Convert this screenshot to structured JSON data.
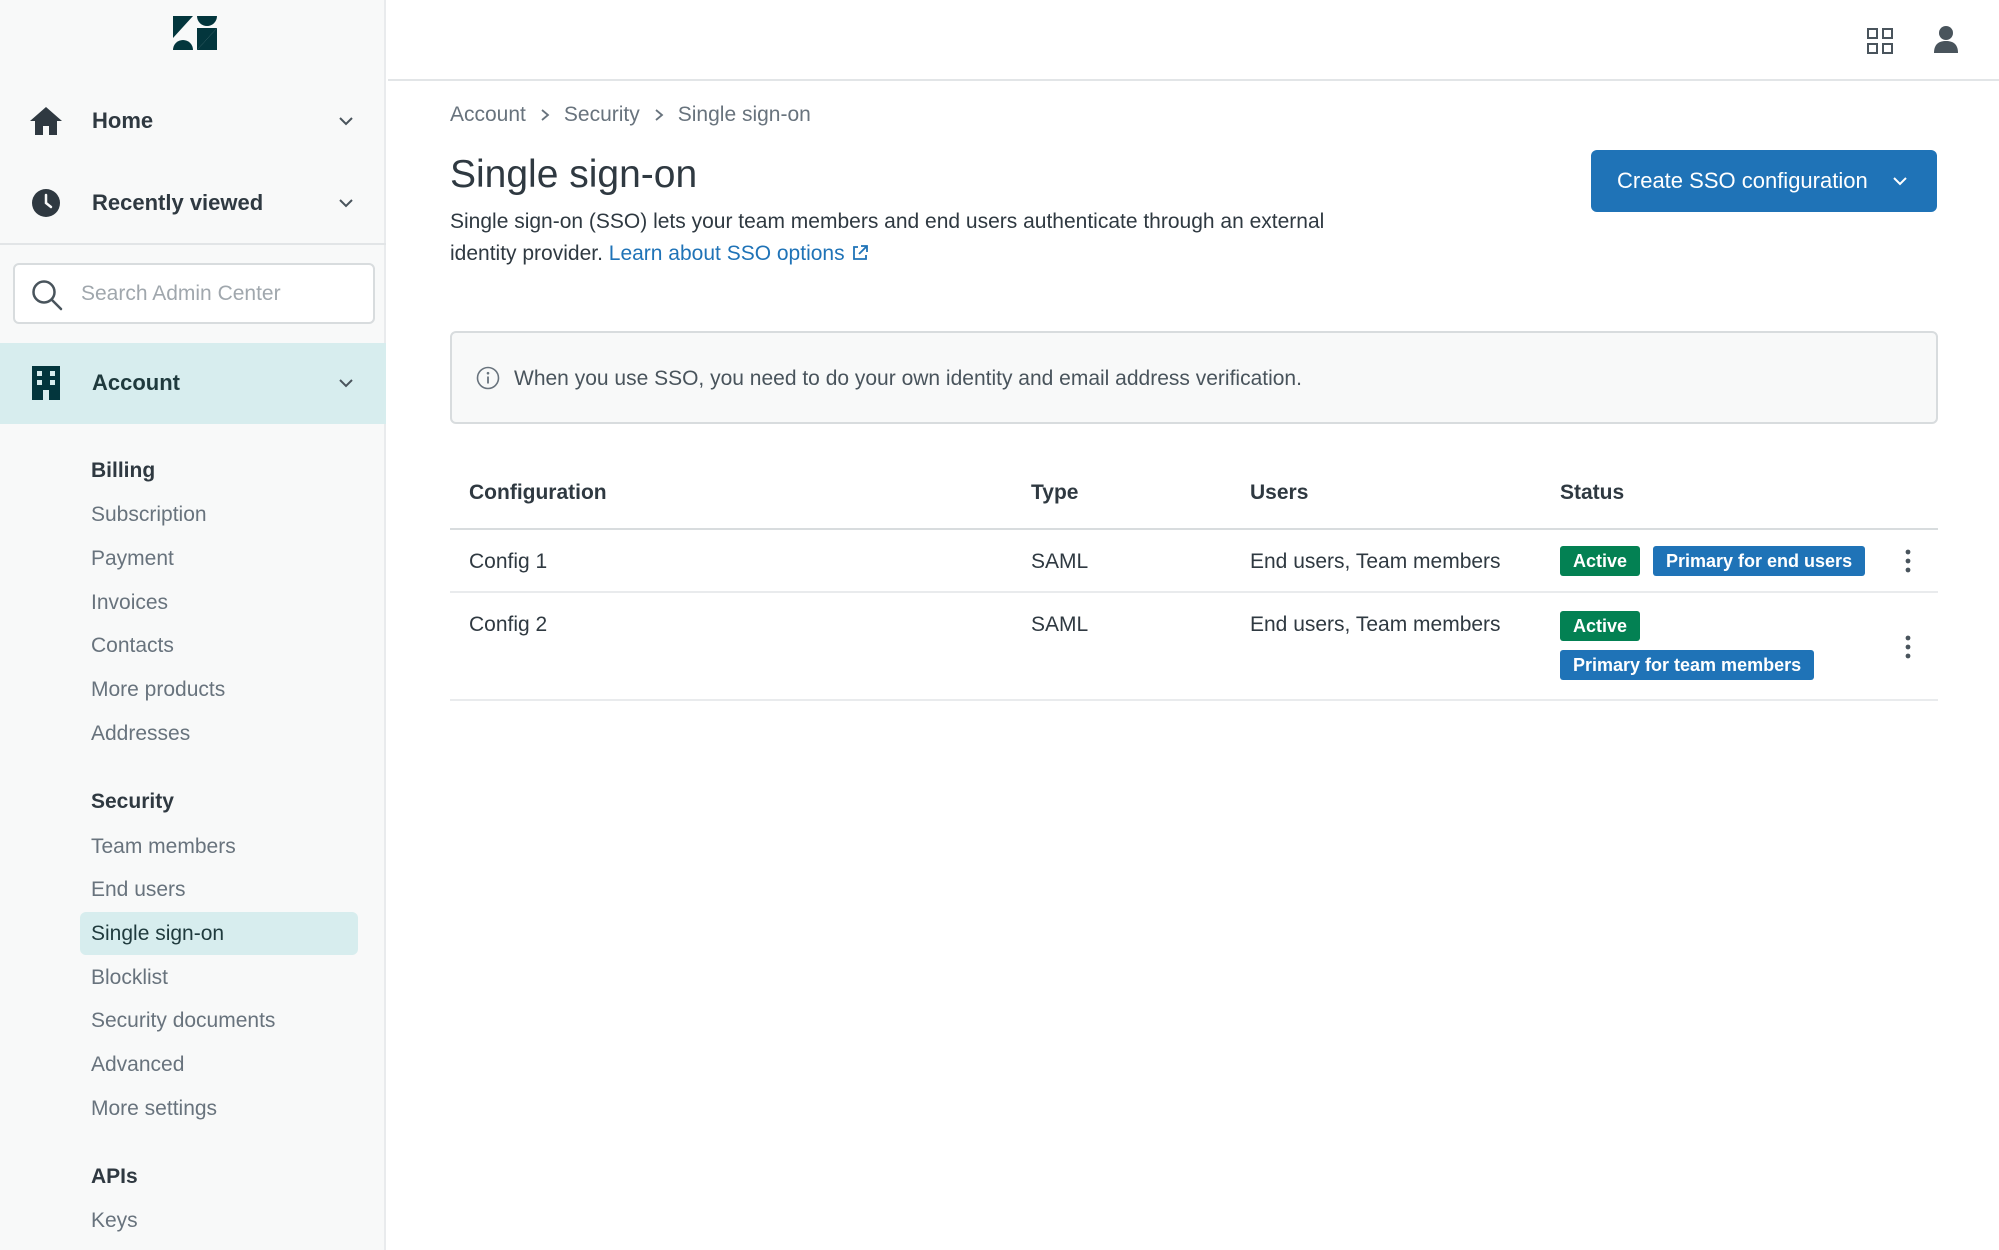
{
  "colors": {
    "accent": "#1f73b7",
    "active_green": "#038153",
    "nav_selected": "#d7edee",
    "sidebar_bg": "#f8f9f9"
  },
  "sidebar": {
    "logo": "zendesk-logo",
    "home": {
      "label": "Home",
      "icon": "home-icon"
    },
    "recently_viewed": {
      "label": "Recently viewed",
      "icon": "clock-icon"
    },
    "search": {
      "placeholder": "Search Admin Center",
      "value": ""
    },
    "account": {
      "label": "Account",
      "icon": "building-icon"
    },
    "sections": [
      {
        "title": "Billing",
        "items": [
          "Subscription",
          "Payment",
          "Invoices",
          "Contacts",
          "More products",
          "Addresses"
        ]
      },
      {
        "title": "Security",
        "items": [
          "Team members",
          "End users",
          "Single sign-on",
          "Blocklist",
          "Security documents",
          "Advanced",
          "More settings"
        ]
      },
      {
        "title": "APIs",
        "items": [
          "Keys"
        ]
      }
    ],
    "active_item": "Single sign-on"
  },
  "topbar": {
    "apps_icon": "grid-icon",
    "user_icon": "user-icon"
  },
  "breadcrumb": [
    "Account",
    "Security",
    "Single sign-on"
  ],
  "page": {
    "title": "Single sign-on",
    "description": "Single sign-on (SSO) lets your team members and end users authenticate through an external identity provider.",
    "link": "Learn about SSO options",
    "create_button": "Create SSO configuration"
  },
  "info": "When you use SSO, you need to do your own identity and email address verification.",
  "table": {
    "headers": [
      "Configuration",
      "Type",
      "Users",
      "Status"
    ],
    "rows": [
      {
        "name": "Config 1",
        "type": "SAML",
        "users": "End users, Team members",
        "status": [
          "Active",
          "Primary for end users"
        ]
      },
      {
        "name": "Config 2",
        "type": "SAML",
        "users": "End users, Team members",
        "status": [
          "Active",
          "Primary for team members"
        ]
      }
    ]
  }
}
